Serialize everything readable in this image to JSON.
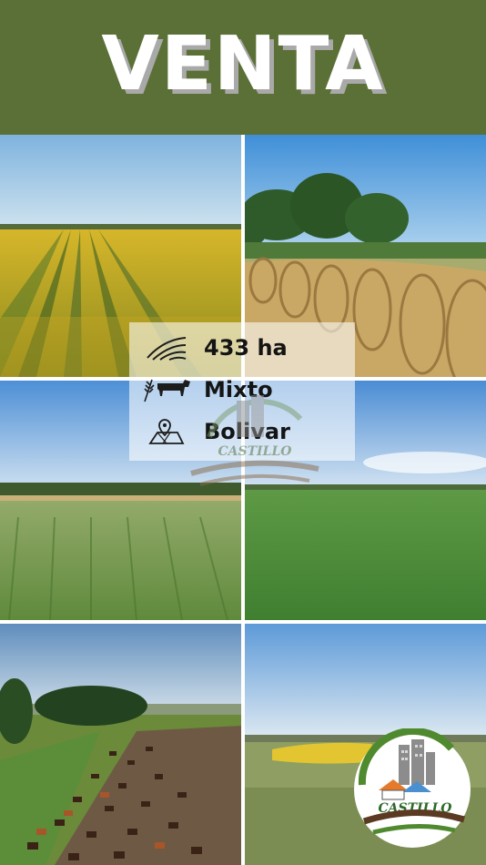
{
  "header": {
    "title": "VENTA"
  },
  "info": {
    "area": "433 ha",
    "use": "Mixto",
    "location": "Bolivar"
  },
  "icons": {
    "area": "field-rows-icon",
    "use": "wheat-cow-icon",
    "location": "map-pin-icon"
  },
  "logo": {
    "brand": "CASTILLO"
  },
  "colors": {
    "header_bg": "#5b7036",
    "title": "#ffffff",
    "title_shadow": "#a9a9a9",
    "logo_green": "#4f8a2e",
    "logo_brown": "#5a3a22"
  }
}
